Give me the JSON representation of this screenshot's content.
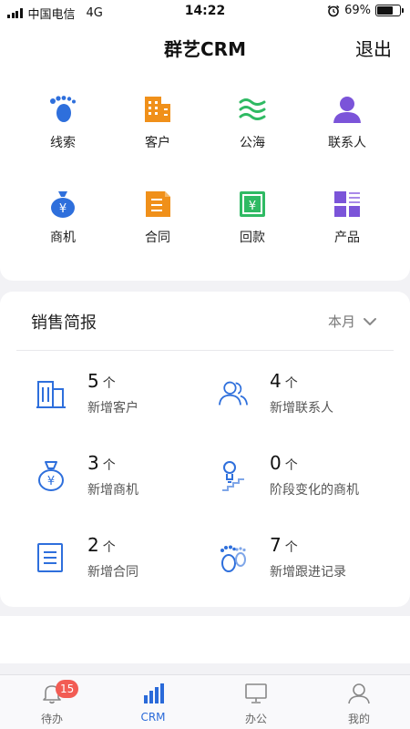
{
  "status_bar": {
    "carrier": "中国电信",
    "network": "4G",
    "time": "14:22",
    "battery_percent": "69%",
    "battery_level": 0.69
  },
  "header": {
    "title": "群艺CRM",
    "logout_label": "退出"
  },
  "modules": [
    {
      "label": "线索",
      "icon": "footprint-icon",
      "color": "#2e6fdc"
    },
    {
      "label": "客户",
      "icon": "building-icon",
      "color": "#f0901a"
    },
    {
      "label": "公海",
      "icon": "waves-icon",
      "color": "#2fba63"
    },
    {
      "label": "联系人",
      "icon": "person-icon",
      "color": "#7b54d9"
    },
    {
      "label": "商机",
      "icon": "money-bag-icon",
      "color": "#2e6fdc"
    },
    {
      "label": "合同",
      "icon": "contract-icon",
      "color": "#f0901a"
    },
    {
      "label": "回款",
      "icon": "payment-icon",
      "color": "#2fba63"
    },
    {
      "label": "产品",
      "icon": "grid-icon",
      "color": "#7b54d9"
    }
  ],
  "sales": {
    "title": "销售简报",
    "period": "本月",
    "unit": "个",
    "stats": [
      {
        "value": "5",
        "label": "新增客户",
        "icon": "building-outline-icon"
      },
      {
        "value": "4",
        "label": "新增联系人",
        "icon": "contacts-outline-icon"
      },
      {
        "value": "3",
        "label": "新增商机",
        "icon": "money-bag-outline-icon"
      },
      {
        "value": "0",
        "label": "阶段变化的商机",
        "icon": "stage-outline-icon"
      },
      {
        "value": "2",
        "label": "新增合同",
        "icon": "document-outline-icon"
      },
      {
        "value": "7",
        "label": "新增跟进记录",
        "icon": "footprint-outline-icon"
      }
    ]
  },
  "tabbar": {
    "tabs": [
      {
        "label": "待办",
        "badge": "15"
      },
      {
        "label": "CRM"
      },
      {
        "label": "办公"
      },
      {
        "label": "我的"
      }
    ]
  },
  "colors": {
    "accent": "#2a6ad9",
    "badge": "#f25c54"
  }
}
